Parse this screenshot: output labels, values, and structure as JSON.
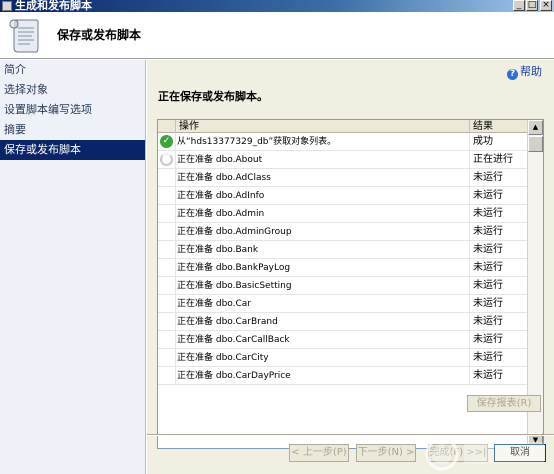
{
  "window": {
    "title": "生成和发布脚本",
    "minimize": "_",
    "maximize": "□",
    "close": "×"
  },
  "header": {
    "title": "保存或发布脚本"
  },
  "sidebar": {
    "items": [
      {
        "label": "简介"
      },
      {
        "label": "选择对象"
      },
      {
        "label": "设置脚本编写选项"
      },
      {
        "label": "摘要"
      },
      {
        "label": "保存或发布脚本"
      }
    ],
    "active_index": 4
  },
  "main": {
    "help_label": "帮助",
    "section_title": "正在保存或发布脚本。",
    "grid": {
      "columns": [
        "操作",
        "结果"
      ],
      "rows": [
        {
          "status": "ok",
          "op": "从“hds13377329_db”获取对象列表。",
          "result": "成功"
        },
        {
          "status": "progress",
          "op": "正在准备 dbo.About",
          "result": "正在进行"
        },
        {
          "status": "none",
          "op": "正在准备 dbo.AdClass",
          "result": "未运行"
        },
        {
          "status": "none",
          "op": "正在准备 dbo.AdInfo",
          "result": "未运行"
        },
        {
          "status": "none",
          "op": "正在准备 dbo.Admin",
          "result": "未运行"
        },
        {
          "status": "none",
          "op": "正在准备 dbo.AdminGroup",
          "result": "未运行"
        },
        {
          "status": "none",
          "op": "正在准备 dbo.Bank",
          "result": "未运行"
        },
        {
          "status": "none",
          "op": "正在准备 dbo.BankPayLog",
          "result": "未运行"
        },
        {
          "status": "none",
          "op": "正在准备 dbo.BasicSetting",
          "result": "未运行"
        },
        {
          "status": "none",
          "op": "正在准备 dbo.Car",
          "result": "未运行"
        },
        {
          "status": "none",
          "op": "正在准备 dbo.CarBrand",
          "result": "未运行"
        },
        {
          "status": "none",
          "op": "正在准备 dbo.CarCallBack",
          "result": "未运行"
        },
        {
          "status": "none",
          "op": "正在准备 dbo.CarCity",
          "result": "未运行"
        },
        {
          "status": "none",
          "op": "正在准备 dbo.CarDayPrice",
          "result": "未运行"
        }
      ]
    },
    "save_report_label": "保存报表(R)",
    "buttons": {
      "prev": "< 上一步(P)",
      "next": "下一步(N) >",
      "finish": "完成(F) >>|",
      "cancel": "取消"
    },
    "watermark": "IDC"
  }
}
